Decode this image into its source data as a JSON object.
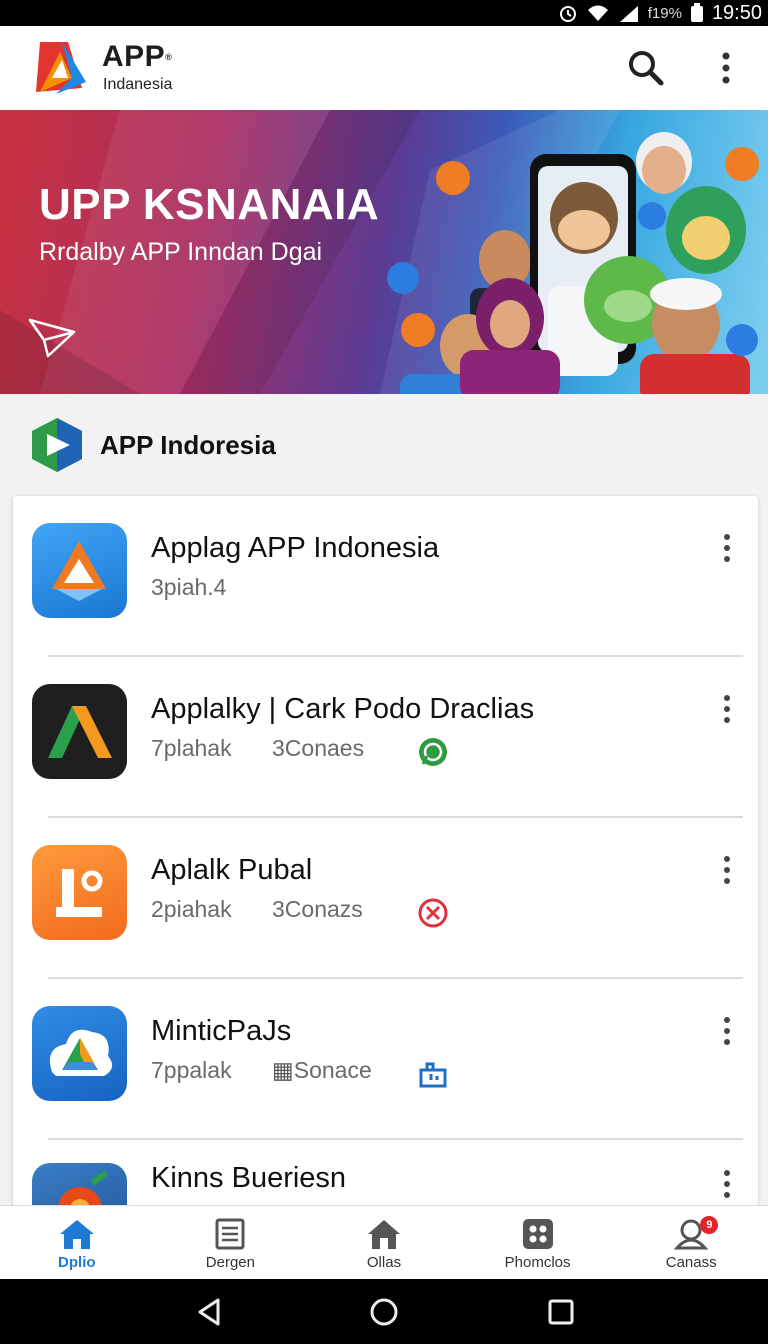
{
  "status_bar": {
    "battery_text": "f19%",
    "time": "19:50"
  },
  "app_bar": {
    "brand": "APP",
    "brand_mark": "®",
    "brand_sub": "Indanesia",
    "search_icon": "search-icon",
    "more_icon": "more-vert-icon"
  },
  "banner": {
    "title": "UPP KSNANAIA",
    "subtitle": "Rrdalby APP Inndan Dgai"
  },
  "section": {
    "title": "APP Indoresia"
  },
  "apps": [
    {
      "name": "Applag APP Indonesia",
      "meta": "3piah.4",
      "meta2": "",
      "status_icon": ""
    },
    {
      "name": "Applalky | Cark Podo Draclias",
      "meta": "7plahak",
      "meta2": "3Conaes",
      "status_icon": "whatsapp-icon",
      "status_color": "#2e9b3e"
    },
    {
      "name": "Aplalk Pubal",
      "meta": "2piahak",
      "meta2": "3Conazs",
      "status_icon": "cancel-icon",
      "status_color": "#e0303a"
    },
    {
      "name": "MinticPaJs",
      "meta": "7ppalak",
      "meta2": "Sonace",
      "status_icon": "store-icon",
      "status_color": "#1f6fc4"
    },
    {
      "name": "Kinns Bueriesn",
      "meta": "",
      "meta2": "",
      "status_icon": ""
    }
  ],
  "bottom_nav": [
    {
      "label": "Dplio",
      "icon": "home-icon",
      "active": true
    },
    {
      "label": "Dergen",
      "icon": "document-icon",
      "active": false
    },
    {
      "label": "Ollas",
      "icon": "home-outline-icon",
      "active": false
    },
    {
      "label": "Phomclos",
      "icon": "grid-icon",
      "active": false
    },
    {
      "label": "Canass",
      "icon": "profile-icon",
      "active": false,
      "badge": "9"
    }
  ],
  "colors": {
    "accent": "#1f7ad6",
    "brand_red": "#e53935",
    "brand_orange": "#f08a24"
  }
}
